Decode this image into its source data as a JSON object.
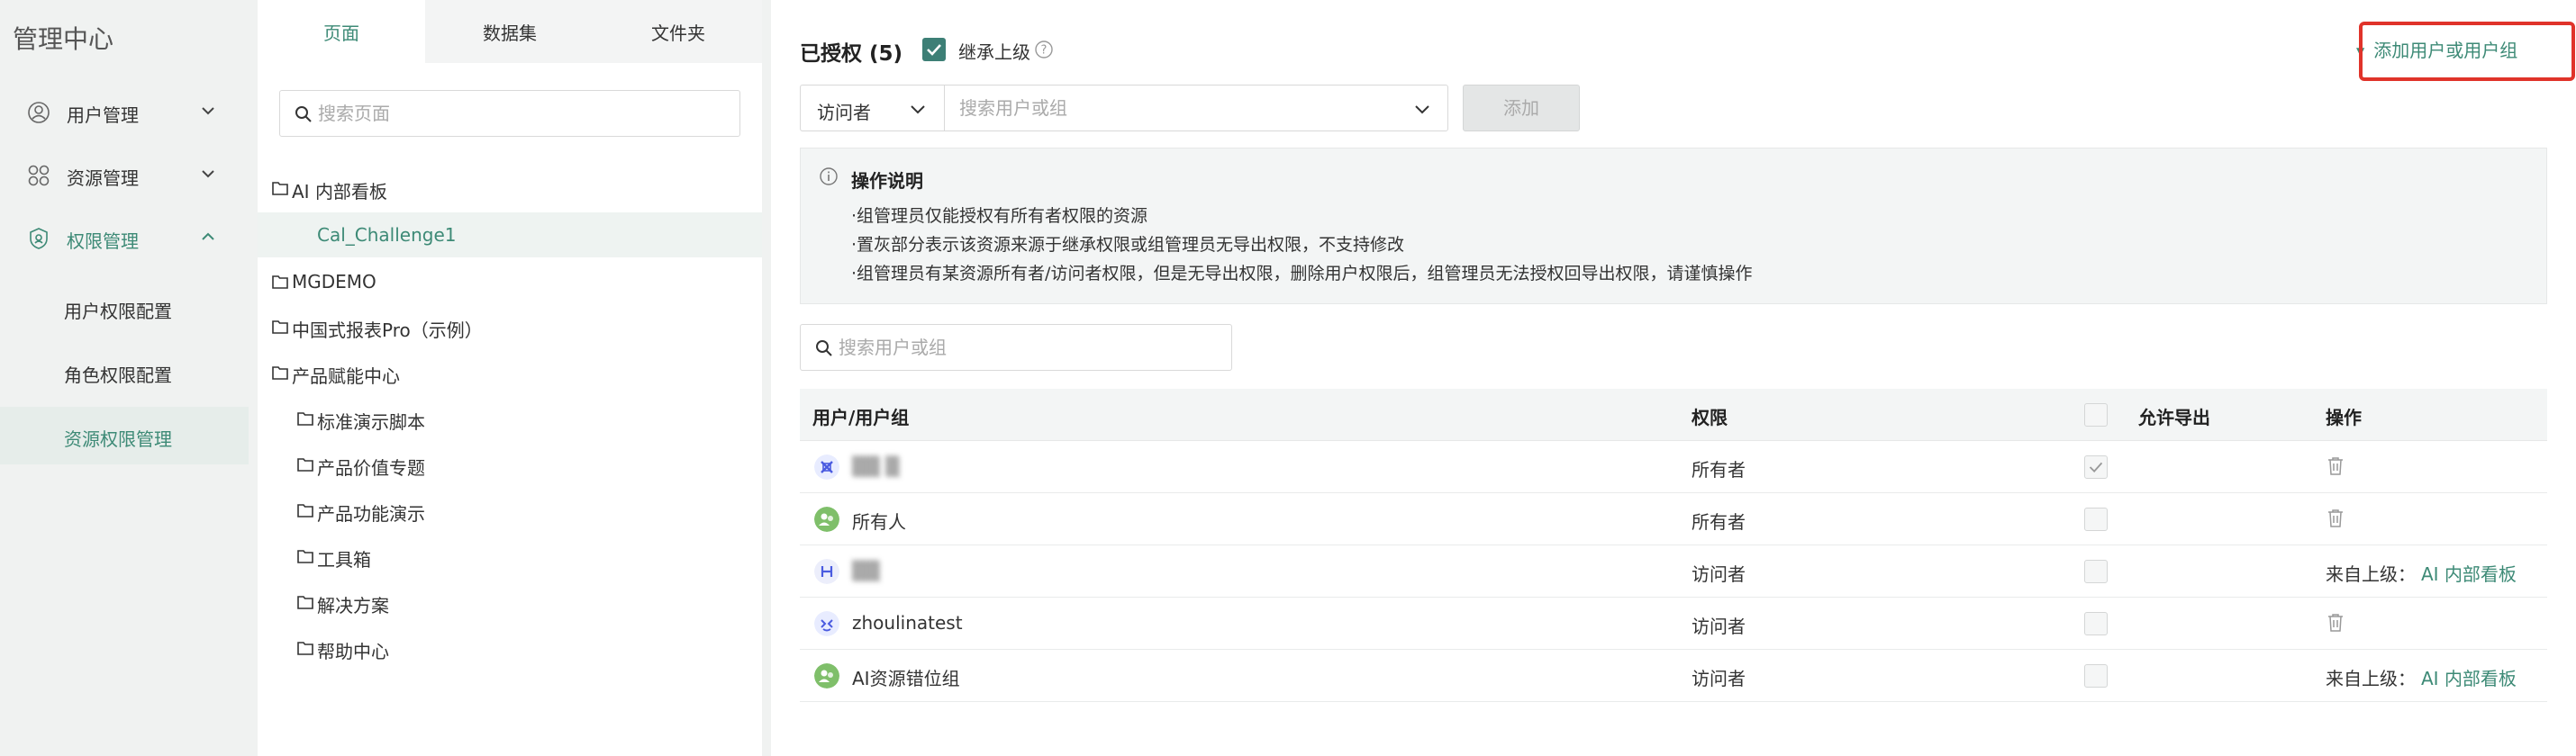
{
  "nav": {
    "title": "管理中心",
    "items": [
      {
        "label": "用户管理",
        "icon": "user-icon"
      },
      {
        "label": "资源管理",
        "icon": "grid-icon"
      },
      {
        "label": "权限管理",
        "icon": "shield-icon"
      }
    ],
    "sub_items": [
      {
        "label": "用户权限配置"
      },
      {
        "label": "角色权限配置"
      },
      {
        "label": "资源权限管理"
      }
    ],
    "active_color": "#3d8a76"
  },
  "tree": {
    "tabs": [
      "页面",
      "数据集",
      "文件夹"
    ],
    "search_placeholder": "搜索页面",
    "nodes": [
      {
        "label": "AI 内部看板"
      },
      {
        "label": "Cal_Challenge1"
      },
      {
        "label": "MGDEMO"
      },
      {
        "label": "中国式报表Pro（示例）"
      },
      {
        "label": "产品赋能中心"
      },
      {
        "label": "标准演示脚本"
      },
      {
        "label": "产品价值专题"
      },
      {
        "label": "产品功能演示"
      },
      {
        "label": "工具箱"
      },
      {
        "label": "解决方案"
      },
      {
        "label": "帮助中心"
      }
    ]
  },
  "main": {
    "title": "已授权 (5)",
    "inherit_label": "继承上级",
    "add_user_link": "添加用户或用户组",
    "role_select": "访问者",
    "user_select_placeholder": "搜索用户或组",
    "add_button": "添加",
    "info": {
      "title": "操作说明",
      "lines": [
        "·组管理员仅能授权有所有者权限的资源",
        "·置灰部分表示该资源来源于继承权限或组管理员无导出权限，不支持修改",
        "·组管理员有某资源所有者/访问者权限，但是无导出权限，删除用户权限后，组管理员无法授权回导出权限，请谨慎操作"
      ]
    },
    "search_placeholder": "搜索用户或组",
    "table": {
      "headers": [
        "用户/用户组",
        "权限",
        "允许导出",
        "操作"
      ],
      "rows": [
        {
          "user": "▒▒ ▒",
          "permission": "所有者",
          "export_checked": true,
          "action": "delete"
        },
        {
          "user": "所有人",
          "permission": "所有者",
          "export_checked": false,
          "action": "delete"
        },
        {
          "user": "▒▒",
          "permission": "访问者",
          "export_checked": false,
          "action": "inherited",
          "from_label": "来自上级：",
          "from_link": "AI 内部看板"
        },
        {
          "user": "zhoulinatest",
          "permission": "访问者",
          "export_checked": false,
          "action": "delete"
        },
        {
          "user": "AI资源错位组",
          "permission": "访问者",
          "export_checked": false,
          "action": "inherited",
          "from_label": "来自上级：",
          "from_link": "AI 内部看板"
        }
      ]
    },
    "highlight_color": "#e0332a"
  }
}
